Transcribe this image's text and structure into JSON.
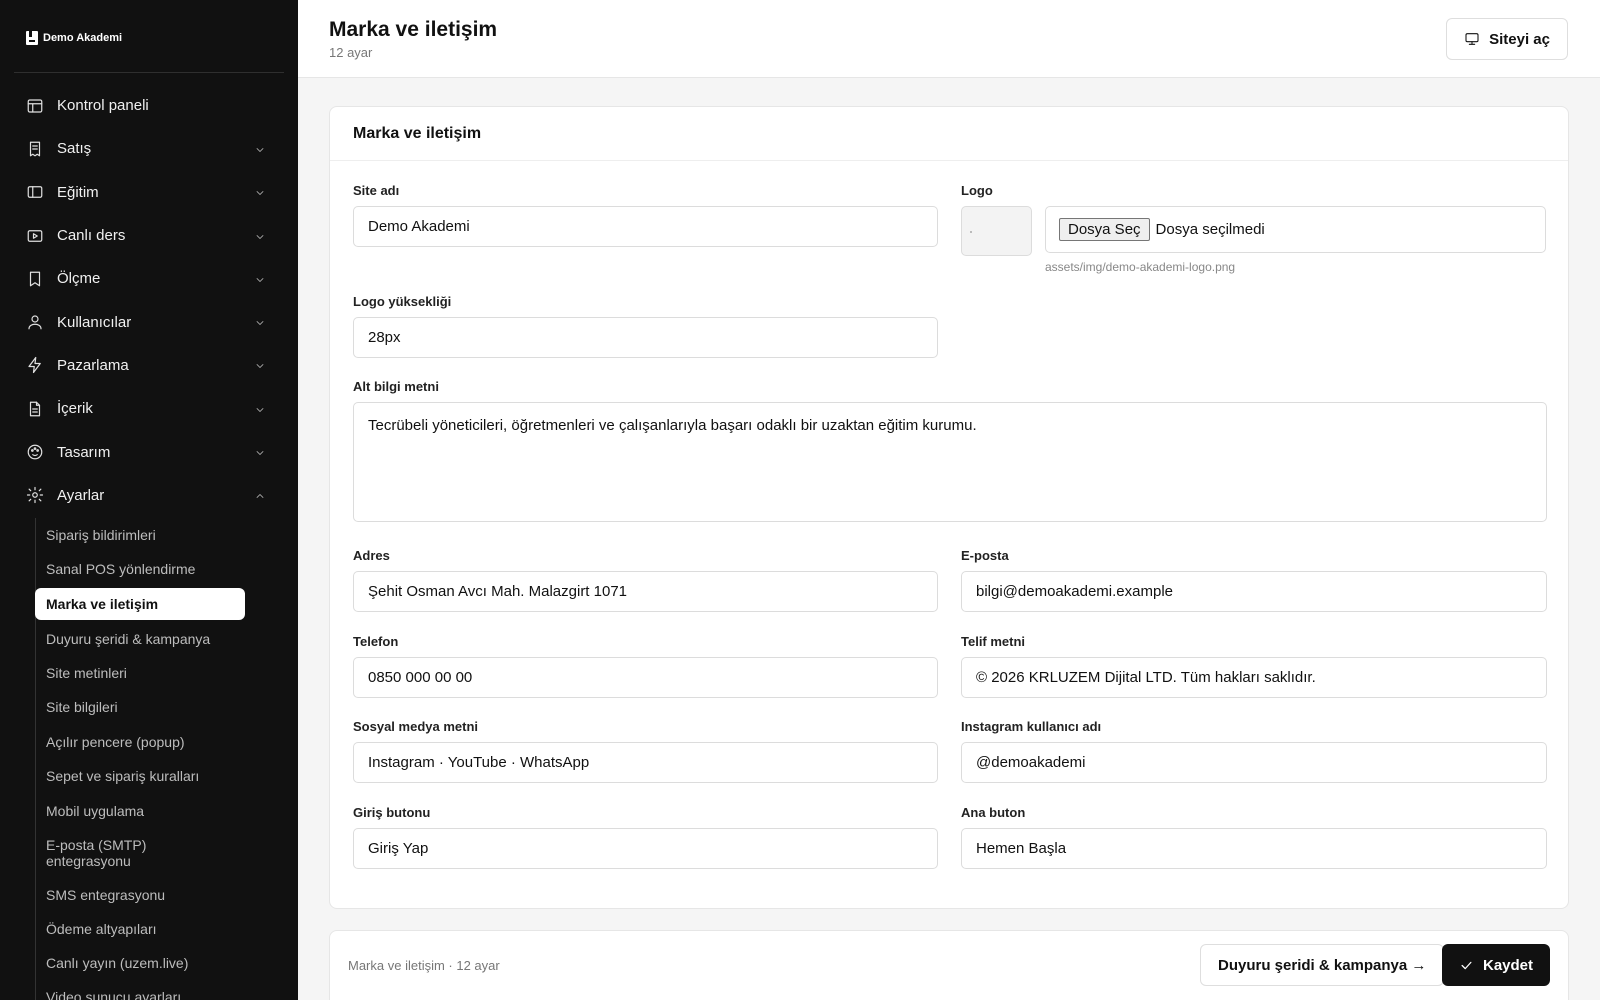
{
  "brand": {
    "name": "Demo Akademi"
  },
  "sidebar": {
    "items": [
      {
        "label": "Kontrol paneli",
        "icon": "layout-icon"
      },
      {
        "label": "Satış",
        "icon": "receipt-icon"
      },
      {
        "label": "Eğitim",
        "icon": "sidebar-panel-icon"
      },
      {
        "label": "Canlı ders",
        "icon": "video-icon"
      },
      {
        "label": "Ölçme",
        "icon": "bookmark-icon"
      },
      {
        "label": "Kullanıcılar",
        "icon": "user-icon"
      },
      {
        "label": "Pazarlama",
        "icon": "bolt-icon"
      },
      {
        "label": "İçerik",
        "icon": "document-icon"
      },
      {
        "label": "Tasarım",
        "icon": "palette-icon"
      },
      {
        "label": "Ayarlar",
        "icon": "gear-icon"
      }
    ],
    "sub_items": [
      "Sipariş bildirimleri",
      "Sanal POS yönlendirme",
      "Marka ve iletişim",
      "Duyuru şeridi & kampanya",
      "Site metinleri",
      "Site bilgileri",
      "Açılır pencere (popup)",
      "Sepet ve sipariş kuralları",
      "Mobil uygulama",
      "E-posta (SMTP) entegrasyonu",
      "SMS entegrasyonu",
      "Ödeme altyapıları",
      "Canlı yayın (uzem.live)",
      "Video sunucu ayarları"
    ],
    "active_sub": "Marka ve iletişim"
  },
  "header": {
    "title": "Marka ve iletişim",
    "subtitle": "12 ayar",
    "open_site_label": "Siteyi aç"
  },
  "card": {
    "title": "Marka ve iletişim",
    "fields": {
      "site_name": {
        "label": "Site adı",
        "value": "Demo Akademi"
      },
      "logo": {
        "label": "Logo",
        "choose_label": "Dosya Seç",
        "no_file": "Dosya seçilmedi",
        "path": "assets/img/demo-akademi-logo.png"
      },
      "logo_height": {
        "label": "Logo yüksekliği",
        "value": "28px"
      },
      "footer_text": {
        "label": "Alt bilgi metni",
        "value": "Tecrübeli yöneticileri, öğretmenleri ve çalışanlarıyla başarı odaklı bir uzaktan eğitim kurumu."
      },
      "address": {
        "label": "Adres",
        "value": "Şehit Osman Avcı Mah. Malazgirt 1071"
      },
      "email": {
        "label": "E-posta",
        "value": "bilgi@demoakademi.example"
      },
      "phone": {
        "label": "Telefon",
        "value": "0850 000 00 00"
      },
      "copyright": {
        "label": "Telif metni",
        "value": "© 2026 KRLUZEM Dijital LTD. Tüm hakları saklıdır."
      },
      "social_text": {
        "label": "Sosyal medya metni",
        "value": "Instagram · YouTube · WhatsApp"
      },
      "instagram": {
        "label": "Instagram kullanıcı adı",
        "value": "@demoakademi"
      },
      "login_button": {
        "label": "Giriş butonu",
        "value": "Giriş Yap"
      },
      "main_button": {
        "label": "Ana buton",
        "value": "Hemen Başla"
      }
    }
  },
  "footer": {
    "info": "Marka ve iletişim · 12 ayar",
    "next_label": "Duyuru şeridi & kampanya →",
    "save_label": "Kaydet"
  }
}
